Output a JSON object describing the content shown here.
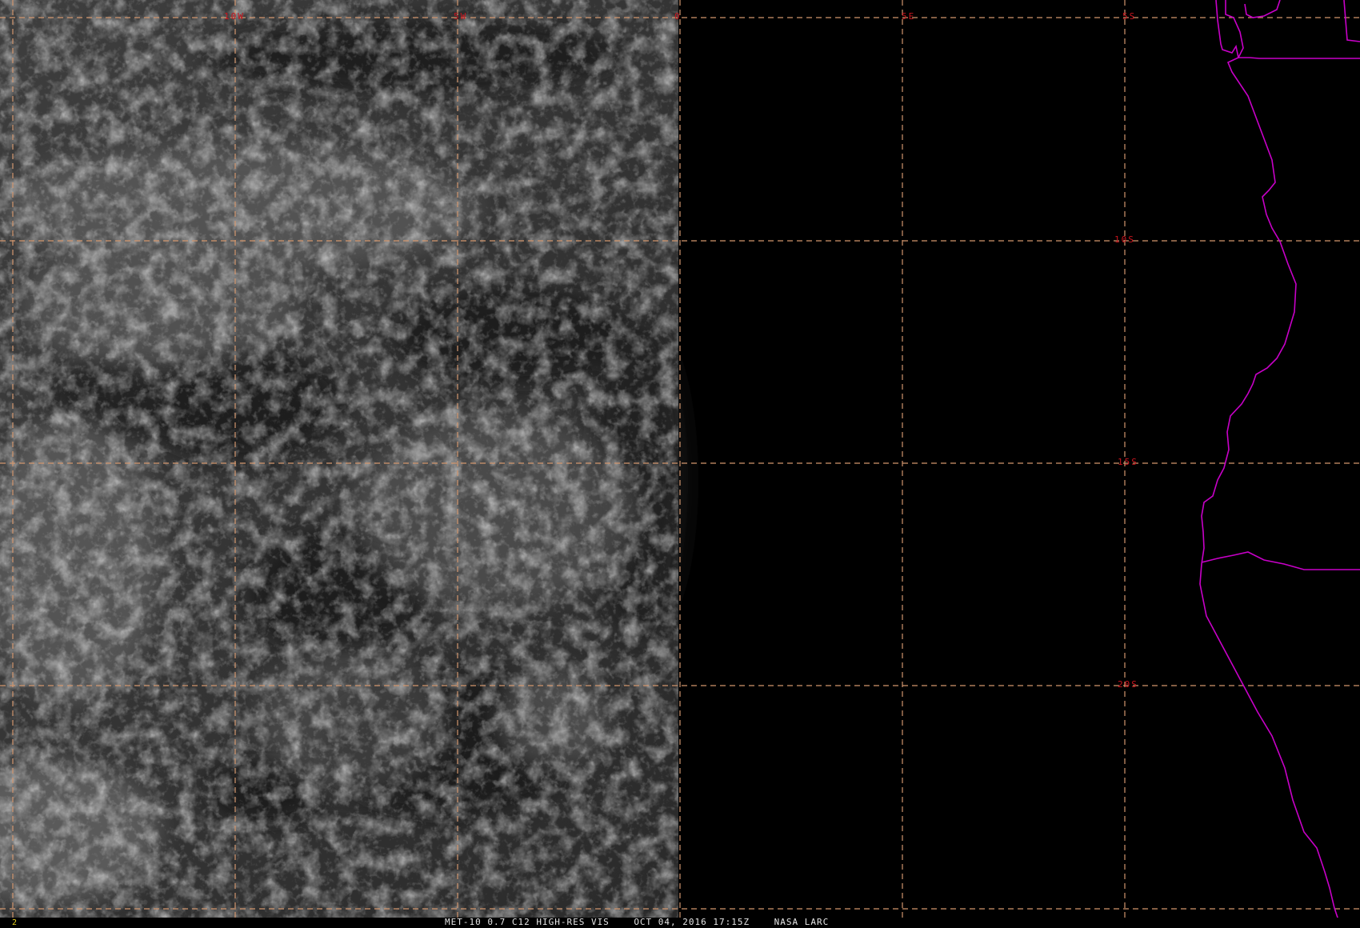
{
  "map": {
    "product": "MET-10 0.7 C12 HIGH-RES VIS",
    "datetime": "OCT 04, 2016 17:15Z",
    "credit": "NASA LARC",
    "frame_number": "2",
    "longitude_labels": [
      "10W",
      "5W",
      "0",
      "5E"
    ],
    "latitude_labels": [
      "5S",
      "10S",
      "15S",
      "20S"
    ],
    "colors": {
      "background": "#000000",
      "grid_line": "#d2966e",
      "grid_label": "#c8141e",
      "coastline": "#c800c8",
      "caption": "#e6e6e6",
      "frame_number": "#e6d21e"
    }
  }
}
